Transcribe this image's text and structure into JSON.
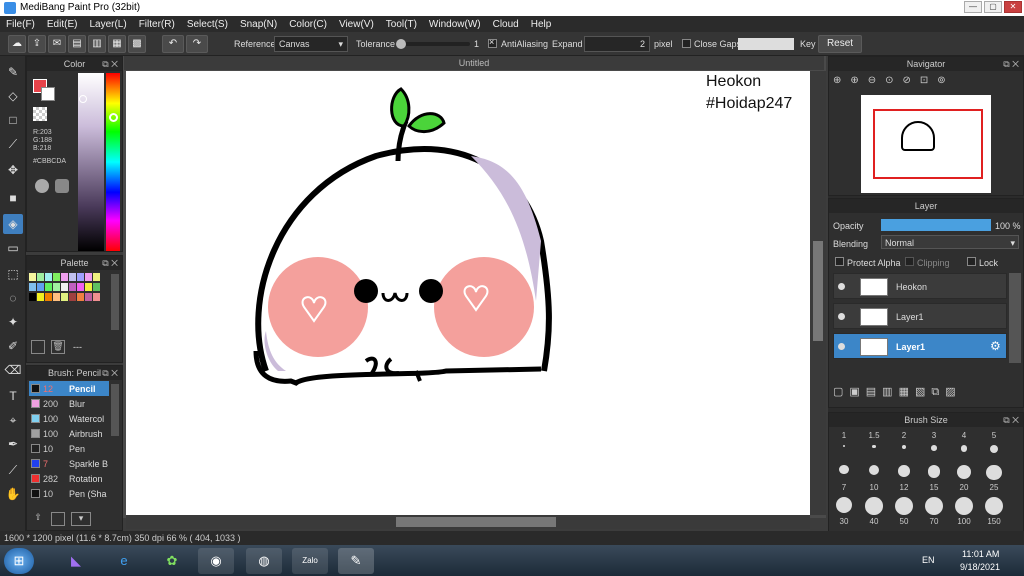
{
  "window": {
    "title": "MediBang Paint Pro (32bit)",
    "min": "—",
    "max": "▢",
    "close": "✕"
  },
  "menu": [
    "File(F)",
    "Edit(E)",
    "Layer(L)",
    "Filter(R)",
    "Select(S)",
    "Snap(N)",
    "Color(C)",
    "View(V)",
    "Tool(T)",
    "Window(W)",
    "Cloud",
    "Help"
  ],
  "toolbar": {
    "reference_label": "Reference",
    "reference_value": "Canvas",
    "tolerance_label": "Tolerance",
    "tolerance_value": "1",
    "antialiasing_label": "AntiAliasing",
    "expand_label": "Expand",
    "expand_value": "2",
    "expand_unit": "pixel",
    "close_gaps_label": "Close Gaps",
    "key_label": "Key",
    "reset_label": "Reset"
  },
  "color_panel": {
    "title": "Color",
    "r": "R:203",
    "g": "G:188",
    "b": "B:218",
    "hex": "#CBBCDA",
    "primary": "#e8434a"
  },
  "palette": {
    "title": "Palette",
    "colors": [
      "#f8f8a0",
      "#a0f0a0",
      "#a0f0f0",
      "#80f060",
      "#f0a0f0",
      "#c0c0f0",
      "#a0a0ff",
      "#f0a0f0",
      "#f0f080",
      "#80c0f0",
      "#60a0f0",
      "#60f060",
      "#a0f0a0",
      "#f0f0f0",
      "#c060c0",
      "#f060f0",
      "#f0f040",
      "#60c060",
      "#000000",
      "#f0f020",
      "#f08000",
      "#ffc080",
      "#e0f080",
      "#a04040",
      "#f08040",
      "#c060a0",
      "#f09090"
    ],
    "sub_label": "---"
  },
  "brush_panel": {
    "title": "Brush: Pencil",
    "items": [
      {
        "size": "12",
        "name": "Pencil",
        "color": "#111111",
        "selected": true
      },
      {
        "size": "200",
        "name": "Blur",
        "color": "#f0a0e0"
      },
      {
        "size": "100",
        "name": "Watercol",
        "color": "#80d0f0"
      },
      {
        "size": "100",
        "name": "Airbrush",
        "color": "#a0a0a0"
      },
      {
        "size": "10",
        "name": "Pen",
        "color": "#222222"
      },
      {
        "size": "7",
        "name": "Sparkle B",
        "color": "#2040f0"
      },
      {
        "size": "282",
        "name": "Rotation",
        "color": "#f03030"
      },
      {
        "size": "10",
        "name": "Pen (Sha",
        "color": "#111111"
      }
    ]
  },
  "document": {
    "tab": "Untitled",
    "watermark_line1": "Heokon",
    "watermark_line2": "#Hoidap247"
  },
  "navigator": {
    "title": "Navigator"
  },
  "layer_panel": {
    "title": "Layer",
    "opacity_label": "Opacity",
    "opacity_value": "100 %",
    "blending_label": "Blending",
    "blending_value": "Normal",
    "protect_alpha": "Protect Alpha",
    "clipping": "Clipping",
    "lock": "Lock",
    "layers": [
      {
        "name": "Heokon",
        "selected": false
      },
      {
        "name": "Layer1",
        "selected": false
      },
      {
        "name": "Layer1",
        "selected": true
      }
    ]
  },
  "brush_size": {
    "title": "Brush Size",
    "sizes": [
      "1",
      "1.5",
      "2",
      "3",
      "4",
      "5",
      "7",
      "10",
      "12",
      "15",
      "20",
      "25",
      "30",
      "40",
      "50",
      "70",
      "100",
      "150"
    ]
  },
  "status": {
    "text": "1600 * 1200 pixel  (11.6 * 8.7cm)  350 dpi  66 %  ( 404, 1033 )"
  },
  "taskbar": {
    "lang": "EN",
    "time": "11:01 AM",
    "date": "9/18/2021",
    "zalo": "Zalo"
  }
}
